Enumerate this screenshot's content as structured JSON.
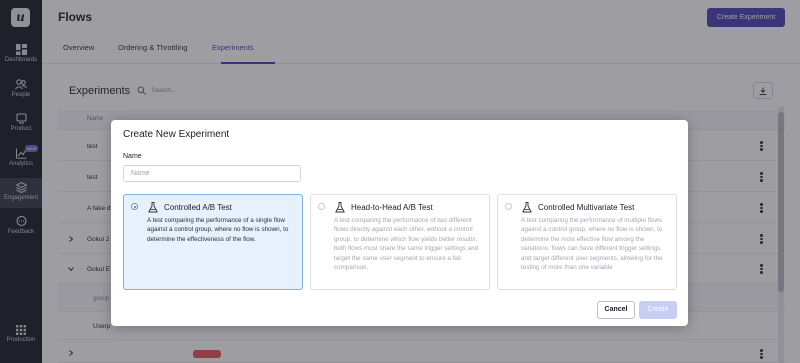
{
  "sidebar": {
    "logo": "u",
    "items": [
      {
        "label": "Dashboards",
        "icon": "dashboard-icon"
      },
      {
        "label": "People",
        "icon": "people-icon"
      },
      {
        "label": "Product",
        "icon": "product-icon"
      },
      {
        "label": "Analytics",
        "icon": "analytics-icon",
        "badge": "NEW"
      },
      {
        "label": "Engagement",
        "icon": "engagement-icon",
        "active": true
      },
      {
        "label": "Feedback",
        "icon": "feedback-icon"
      },
      {
        "label": "Production",
        "icon": "apps-grid-icon"
      }
    ]
  },
  "header": {
    "title": "Flows",
    "create_button": "Create Experiment",
    "tabs": [
      {
        "label": "Overview"
      },
      {
        "label": "Ordering & Throttling"
      },
      {
        "label": "Experiments",
        "active": true
      }
    ]
  },
  "experiments": {
    "title": "Experiments",
    "search_placeholder": "Search...",
    "column_name": "Name",
    "rows": [
      {
        "name": "test"
      },
      {
        "name": "test"
      },
      {
        "name": "A fake d"
      },
      {
        "name": "Gokul 2"
      },
      {
        "name": "Gokul E"
      },
      {
        "name": "group"
      },
      {
        "name": "Userp"
      }
    ]
  },
  "modal": {
    "title": "Create New Experiment",
    "name_label": "Name",
    "name_placeholder": "Name",
    "cards": [
      {
        "title": "Controlled A/B Test",
        "description": "A test comparing the performance of a single flow against a control group, where no flow is shown, to determine the effectiveness of the flow.",
        "selected": true,
        "icon": "flask-icon"
      },
      {
        "title": "Head-to-Head A/B Test",
        "description": "A test comparing the performance of two different flows directly against each other, without a control group, to determine which flow yields better results; both flows must share the same trigger settings and target the same user segment to ensure a fair comparison.",
        "selected": false,
        "icon": "flask-icon"
      },
      {
        "title": "Controlled Multivariate Test",
        "description": "A test comparing the performance of multiple flows against a control group, where no flow is shown, to determine the most effective flow among the variations; flows can have different trigger settings and target different user segments, allowing for the testing of more than one variable",
        "selected": false,
        "icon": "flask-icon"
      }
    ],
    "cancel_label": "Cancel",
    "create_label": "Create"
  },
  "colors": {
    "sidebar_bg": "#1b1b26",
    "accent": "#4a3fb8",
    "selected_card_bg": "#e6f1fc",
    "create_disabled": "#c8cdf3"
  }
}
